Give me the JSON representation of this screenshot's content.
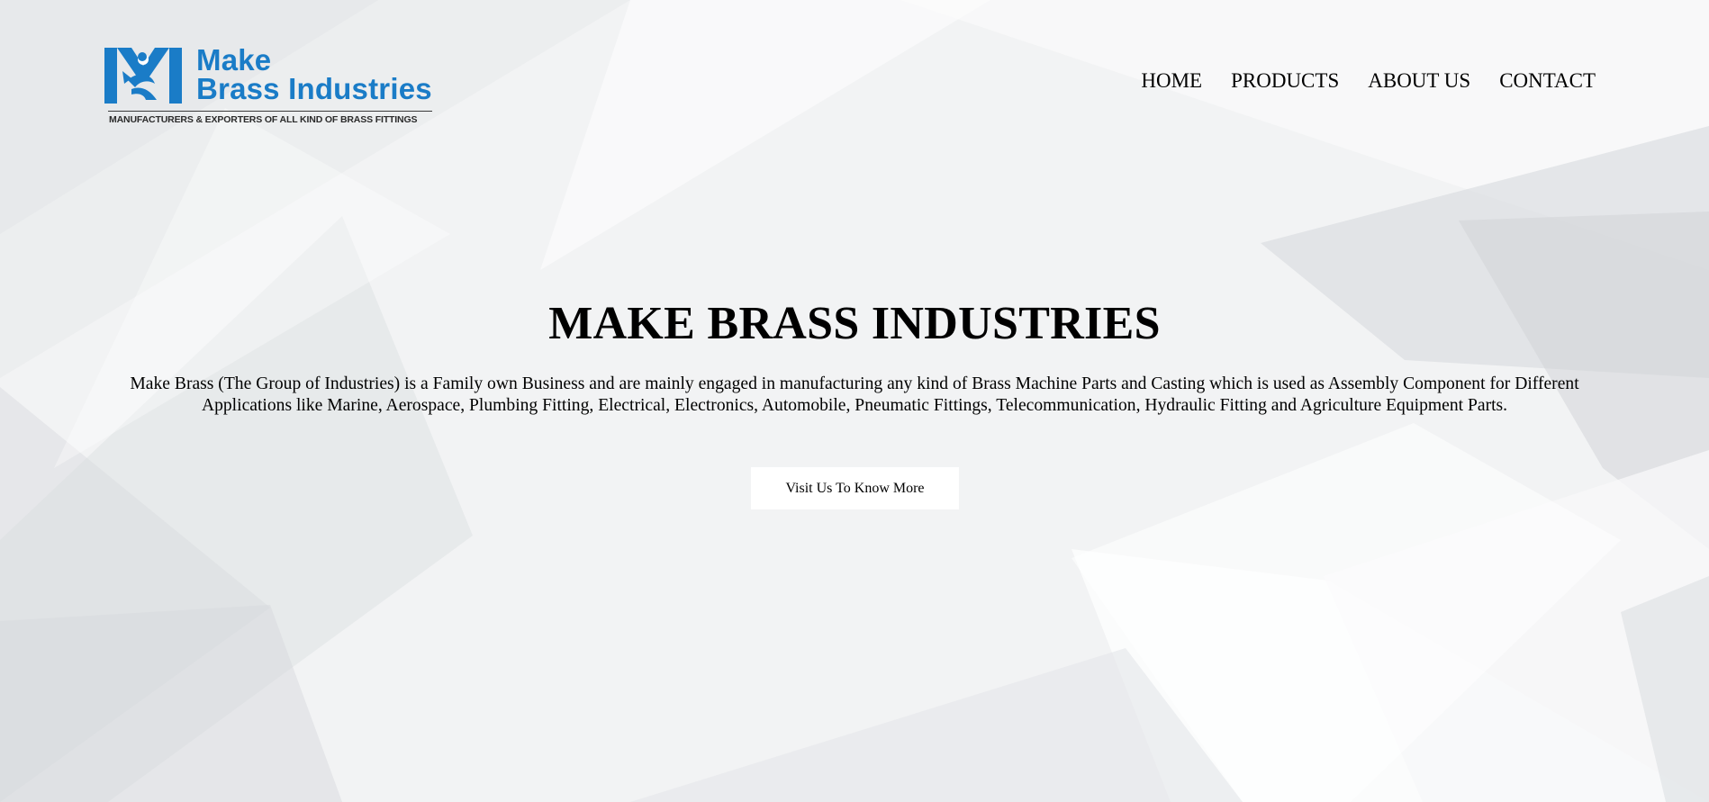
{
  "header": {
    "logo": {
      "line1": "Make",
      "line2": "Brass Industries",
      "tagline": "MANUFACTURERS & EXPORTERS OF ALL KIND OF BRASS FITTINGS",
      "brand_color": "#1a7cc7"
    },
    "nav": [
      {
        "label": "HOME"
      },
      {
        "label": "PRODUCTS"
      },
      {
        "label": "ABOUT US"
      },
      {
        "label": "CONTACT"
      }
    ]
  },
  "hero": {
    "title": "MAKE BRASS INDUSTRIES",
    "description": "Make Brass (The Group of Industries) is a Family own Business and are mainly engaged in manufacturing any kind of Brass Machine Parts and Casting which is used as Assembly Component for Different Applications like Marine, Aerospace, Plumbing Fitting, Electrical, Electronics, Automobile, Pneumatic Fittings, Telecommunication, Hydraulic Fitting and Agriculture Equipment Parts.",
    "cta_label": "Visit Us To Know More"
  },
  "colors": {
    "background": "#f3f4f5",
    "button_bg": "#ffffff",
    "text": "#000000"
  }
}
